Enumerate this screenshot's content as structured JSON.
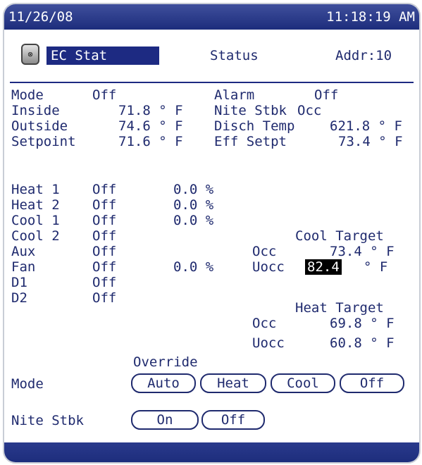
{
  "header": {
    "date": "11/26/08",
    "time": "11:18:19 AM"
  },
  "device": {
    "icon": "thermostat-icon",
    "icon_glyph": "⊗",
    "name": "EC Stat",
    "status_label": "Status",
    "addr_label": "Addr:10"
  },
  "summary": {
    "mode": {
      "label": "Mode",
      "value": "Off"
    },
    "inside": {
      "label": "Inside",
      "value": "71.8 ° F"
    },
    "outside": {
      "label": "Outside",
      "value": "74.6 ° F"
    },
    "setpoint": {
      "label": "Setpoint",
      "value": "71.6 ° F"
    },
    "alarm": {
      "label": "Alarm",
      "value": "Off"
    },
    "nite_stbk": {
      "label": "Nite Stbk",
      "value": "Occ"
    },
    "disch_temp": {
      "label": "Disch Temp",
      "value": "621.8 ° F"
    },
    "eff_setpt": {
      "label": "Eff Setpt",
      "value": "73.4 ° F"
    }
  },
  "stages": [
    {
      "label": "Heat 1",
      "state": "Off",
      "pct": "0.0 %"
    },
    {
      "label": "Heat 2",
      "state": "Off",
      "pct": "0.0 %"
    },
    {
      "label": "Cool 1",
      "state": "Off",
      "pct": "0.0 %"
    },
    {
      "label": "Cool 2",
      "state": "Off",
      "pct": ""
    },
    {
      "label": "Aux",
      "state": "Off",
      "pct": ""
    },
    {
      "label": "Fan",
      "state": "Off",
      "pct": "0.0 %"
    },
    {
      "label": "D1",
      "state": "Off",
      "pct": ""
    },
    {
      "label": "D2",
      "state": "Off",
      "pct": ""
    }
  ],
  "cool_target": {
    "title": "Cool Target",
    "occ_label": "Occ",
    "occ_value": "73.4 ° F",
    "uocc_label": "Uocc",
    "uocc_value": "82.4",
    "uocc_unit": "° F"
  },
  "heat_target": {
    "title": "Heat Target",
    "occ_label": "Occ",
    "occ_value": "69.8 ° F",
    "uocc_label": "Uocc",
    "uocc_value": "60.8 ° F"
  },
  "override": {
    "title": "Override",
    "mode_label": "Mode",
    "mode_buttons": [
      "Auto",
      "Heat",
      "Cool",
      "Off"
    ],
    "nite_label": "Nite Stbk",
    "nite_buttons": [
      "On",
      "Off"
    ]
  }
}
